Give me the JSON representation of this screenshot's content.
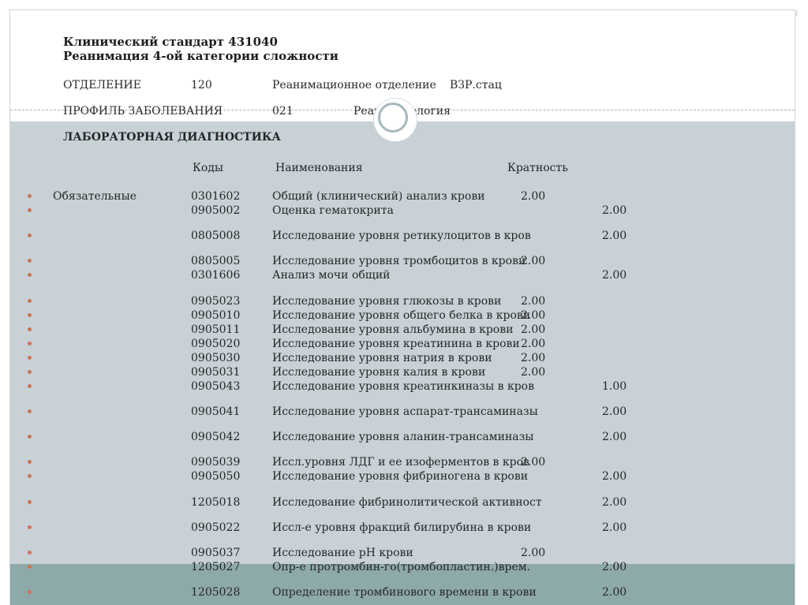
{
  "title_line1": "Клинический стандарт 431040",
  "title_line2": "Реанимация 4-ой категории сложности",
  "department": {
    "label": "ОТДЕЛЕНИЕ",
    "code": "120",
    "name": "Реанимационное отделение",
    "type": "ВЗР.стац"
  },
  "profile": {
    "label": "ПРОФИЛЬ ЗАБОЛЕВАНИЯ",
    "code": "021",
    "name": "Реаниматология"
  },
  "section_title": "ЛАБОРАТОРНАЯ ДИАГНОСТИКА",
  "columns": {
    "codes": "Коды",
    "names": "Наименования",
    "frequency": "Кратность"
  },
  "required_label": "Обязательные",
  "rows": [
    {
      "code": "0301602",
      "name": "Общий (клинический) анализ крови",
      "qty": "2.00",
      "col": "mid"
    },
    {
      "code": "0905002",
      "name": "Оценка гематокрита",
      "qty": "2.00",
      "col": "right"
    },
    {
      "code": "0805008",
      "name": "Исследование уровня ретикулоцитов в кров",
      "qty": "2.00",
      "col": "right"
    },
    {
      "code": "0805005",
      "name": "Исследование уровня тромбоцитов в крови",
      "qty": "2.00",
      "col": "mid"
    },
    {
      "code": "0301606",
      "name": "Анализ мочи общий",
      "qty": "2.00",
      "col": "right"
    },
    {
      "code": "0905023",
      "name": "Исследование уровня глюкозы в крови",
      "qty": "2.00",
      "col": "mid"
    },
    {
      "code": "0905010",
      "name": "Исследование уровня общего белка в крови",
      "qty": "2.00",
      "col": "mid"
    },
    {
      "code": "0905011",
      "name": "Исследование уровня альбумина в крови",
      "qty": "2.00",
      "col": "mid"
    },
    {
      "code": "0905020",
      "name": "Исследование уровня креатинина в крови",
      "qty": "2.00",
      "col": "mid"
    },
    {
      "code": "0905030",
      "name": "Исследование уровня натрия в крови",
      "qty": "2.00",
      "col": "mid"
    },
    {
      "code": "0905031",
      "name": "Исследование уровня калия в крови",
      "qty": "2.00",
      "col": "mid"
    },
    {
      "code": "0905043",
      "name": "Исследование уровня креатинкиназы в кров",
      "qty": "1.00",
      "col": "right"
    },
    {
      "code": "0905041",
      "name": "Исследование уровня аспарат-трансаминазы",
      "qty": "2.00",
      "col": "right"
    },
    {
      "code": "0905042",
      "name": "Исследование уровня аланин-трансаминазы",
      "qty": "2.00",
      "col": "right"
    },
    {
      "code": "0905039",
      "name": "Иссл.уровня ЛДГ и ее изоферментов в кров",
      "qty": "2.00",
      "col": "mid"
    },
    {
      "code": "0905050",
      "name": "Исследование уровня фибриногена в крови",
      "qty": "2.00",
      "col": "right"
    },
    {
      "code": "1205018",
      "name": "Исследование фибринолитической активност",
      "qty": "2.00",
      "col": "right"
    },
    {
      "code": "0905022",
      "name": "Иссл-е уровня фракций билирубина в крови",
      "qty": "2.00",
      "col": "right"
    },
    {
      "code": "0905037",
      "name": "Исследование pH крови",
      "qty": "2.00",
      "col": "mid"
    },
    {
      "code": "1205027",
      "name": "Опр-е протромбин-го(тромбопластин.)врем.",
      "qty": "2.00",
      "col": "right"
    },
    {
      "code": "1205028",
      "name": "Определение тромбинового времени в крови",
      "qty": "2.00",
      "col": "right"
    }
  ],
  "colors": {
    "body_band": "#c7d1d6",
    "footer_band": "#8ea9aa",
    "bullet": "#cc7358"
  }
}
